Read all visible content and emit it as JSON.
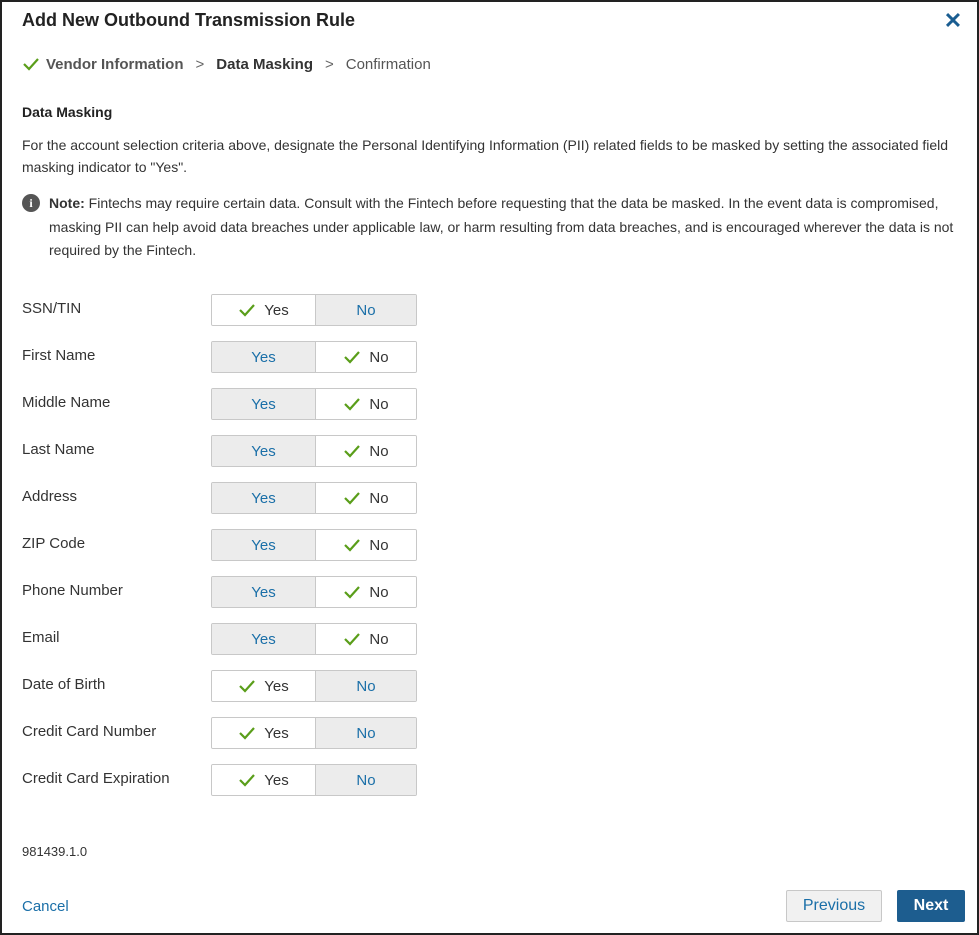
{
  "dialog": {
    "title": "Add New Outbound Transmission Rule",
    "close_glyph": "✕"
  },
  "steps": [
    {
      "label": "Vendor Information",
      "state": "done"
    },
    {
      "label": "Data Masking",
      "state": "current"
    },
    {
      "label": "Confirmation",
      "state": "pending"
    }
  ],
  "section": {
    "title": "Data Masking",
    "description": "For the account selection criteria above, designate the Personal Identifying Information (PII) related fields to be masked by setting the associated field masking indicator to \"Yes\".",
    "note_label": "Note:",
    "note_text": " Fintechs may require certain data. Consult with the Fintech before requesting that the data be masked. In the event data is compromised, masking PII can help avoid data breaches under applicable law, or harm resulting from data breaches, and is encouraged wherever the data is not required by the Fintech.",
    "note_icon_glyph": "i"
  },
  "toggle_labels": {
    "yes": "Yes",
    "no": "No"
  },
  "fields": [
    {
      "label": "SSN/TIN",
      "value": "Yes"
    },
    {
      "label": "First Name",
      "value": "No"
    },
    {
      "label": "Middle Name",
      "value": "No"
    },
    {
      "label": "Last Name",
      "value": "No"
    },
    {
      "label": "Address",
      "value": "No"
    },
    {
      "label": "ZIP Code",
      "value": "No"
    },
    {
      "label": "Phone Number",
      "value": "No"
    },
    {
      "label": "Email",
      "value": "No"
    },
    {
      "label": "Date of Birth",
      "value": "Yes"
    },
    {
      "label": "Credit Card Number",
      "value": "Yes"
    },
    {
      "label": "Credit Card Expiration",
      "value": "Yes"
    }
  ],
  "version": "981439.1.0",
  "footer": {
    "cancel_label": "Cancel",
    "previous_label": "Previous",
    "next_label": "Next"
  },
  "colors": {
    "link": "#1a6fa8",
    "primary": "#1d5d8f",
    "check": "#5a9e1a"
  }
}
